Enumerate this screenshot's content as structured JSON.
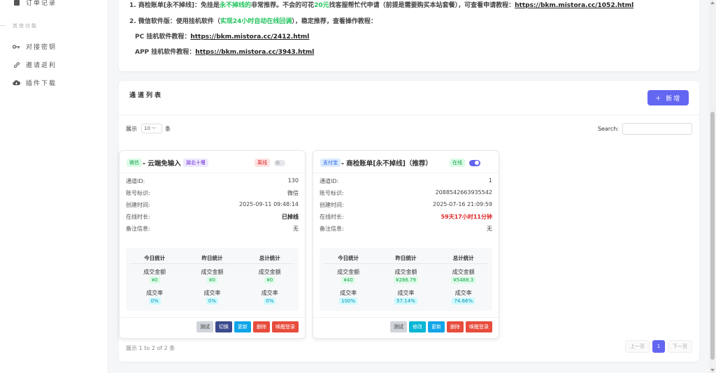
{
  "sidebar": {
    "items": [
      {
        "label": "订单记录",
        "icon": "order-list-icon"
      },
      {
        "label": "对接密钥",
        "icon": "key-icon"
      },
      {
        "label": "邀请返利",
        "icon": "link-icon"
      },
      {
        "label": "插件下载",
        "icon": "cloud-download-icon"
      }
    ],
    "section_title": "其他功能"
  },
  "notice": {
    "line1": {
      "prefix": "1. 商检账单[永不掉线]：免挂是",
      "highlight1": "永不掉线的",
      "middle": "非常推荐。不会的可花",
      "highlight2": "20元",
      "suffix": "找客服帮忙代申请（前提是需要购买本站套餐），可查看申请教程：",
      "url": "https://bkm.mistora.cc/1052.html"
    },
    "line2": {
      "prefix": "2. 微信软件版：使用挂机软件（",
      "highlight": "实现24小时自动在线回调",
      "suffix": "），稳定推荐，查看操作教程："
    },
    "line3": {
      "label": "PC 挂机软件教程：",
      "url": "https://bkm.mistora.cc/2412.html"
    },
    "line4": {
      "label": "APP 挂机软件教程：",
      "url": "https://bkm.mistora.cc/3943.html"
    }
  },
  "list": {
    "title": "通道列表",
    "add_label": "＋ 新增",
    "show_prefix": "展示",
    "show_value": "10",
    "show_suffix": "条",
    "search_label": "Search:",
    "footer_info": "展示 1 to 2 of 2 条",
    "pager": {
      "prev": "上一页",
      "page": "1",
      "next": "下一页"
    }
  },
  "labels": {
    "channel_id": "通道ID:",
    "account": "账号标识:",
    "created": "创建时间:",
    "online": "在线时长:",
    "remark": "备注信息:",
    "today": "今日统计",
    "yesterday": "昨日统计",
    "total": "总计统计",
    "amount": "成交金额",
    "rate": "成交率"
  },
  "channels": [
    {
      "type_tag": "微信",
      "name": " - 云端免输入",
      "region_tag": "湖北十堰",
      "status": "离线",
      "enabled": false,
      "channel_id": "130",
      "account": "微信",
      "created": "2025-09-11 09:48:14",
      "online": "已掉线",
      "remark": "无",
      "today_amount": "¥0",
      "yesterday_amount": "¥0",
      "total_amount": "¥0",
      "today_rate": "0%",
      "yesterday_rate": "0%",
      "total_rate": "0%",
      "actions": [
        "测试",
        "切换",
        "更新",
        "删除",
        "唤醒登录"
      ]
    },
    {
      "type_tag": "支付宝",
      "name": " - 商检账单[永不掉线]（推荐）",
      "status": "在线",
      "enabled": true,
      "channel_id": "1",
      "account": "2088542663935542",
      "created": "2025-07-16 21:09:59",
      "online": "59天17小时11分钟",
      "remark": "无",
      "today_amount": "¥40",
      "yesterday_amount": "¥286.79",
      "total_amount": "¥5488.3",
      "today_rate": "100%",
      "yesterday_rate": "57.14%",
      "total_rate": "74.66%",
      "actions": [
        "测试",
        "修改",
        "更新",
        "删除",
        "唤醒登录"
      ]
    }
  ],
  "colors": {
    "accent": "#6366f1",
    "danger": "#dc2626",
    "success": "#22c55e"
  }
}
